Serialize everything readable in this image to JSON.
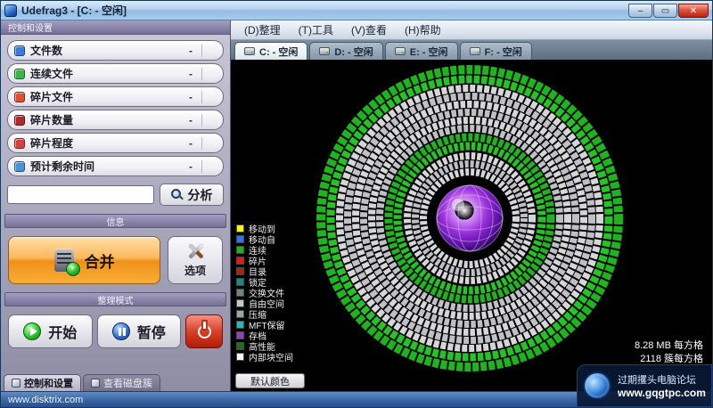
{
  "window": {
    "title": "Udefrag3 - [C: - 空闲]",
    "controls": {
      "minimize": "–",
      "maximize": "▭",
      "close": "✕"
    }
  },
  "menu": {
    "items": [
      "(D)整理",
      "(T)工具",
      "(V)查看",
      "(H)帮助"
    ]
  },
  "drive_tabs": [
    {
      "label": "C: - 空闲",
      "active": true
    },
    {
      "label": "D: - 空闲",
      "active": false
    },
    {
      "label": "E: - 空闲",
      "active": false
    },
    {
      "label": "F: - 空闲",
      "active": false
    }
  ],
  "left_panel": {
    "header": "控制和设置",
    "stats": [
      {
        "label": "文件数",
        "value": "-",
        "icon_color": "#3a7bd5"
      },
      {
        "label": "连续文件",
        "value": "-",
        "icon_color": "#3ab54a"
      },
      {
        "label": "碎片文件",
        "value": "-",
        "icon_color": "#e05030"
      },
      {
        "label": "碎片数量",
        "value": "-",
        "icon_color": "#b02828"
      },
      {
        "label": "碎片程度",
        "value": "-",
        "icon_color": "#d84040"
      },
      {
        "label": "预计剩余时间",
        "value": "-",
        "icon_color": "#4a90d9"
      }
    ],
    "analyze_input_value": "",
    "analyze_button": "分析",
    "info_header": "信息",
    "merge_button": "合并",
    "options_button": "选项",
    "mode_header": "整理模式",
    "start_button": "开始",
    "pause_button": "暂停",
    "bottom_tabs": [
      {
        "label": "控制和设置",
        "active": true
      },
      {
        "label": "查看磁盘簇",
        "active": false
      }
    ]
  },
  "canvas": {
    "legend": [
      {
        "label": "移动到",
        "color": "#f8f800"
      },
      {
        "label": "移动自",
        "color": "#2878f0"
      },
      {
        "label": "连续",
        "color": "#18b418"
      },
      {
        "label": "碎片",
        "color": "#e81818"
      },
      {
        "label": "目录",
        "color": "#a02810"
      },
      {
        "label": "锁定",
        "color": "#188888"
      },
      {
        "label": "交换文件",
        "color": "#6a8878"
      },
      {
        "label": "自由空间",
        "color": "#c8c8c8"
      },
      {
        "label": "压缩",
        "color": "#90a8b0"
      },
      {
        "label": "MFT保留",
        "color": "#28b8b8"
      },
      {
        "label": "存档",
        "color": "#9040c0"
      },
      {
        "label": "高性能",
        "color": "#1a701a"
      },
      {
        "label": "内部块空间",
        "color": "#f8f8f8"
      }
    ],
    "block_size_info": "8.28 MB 每方格",
    "cluster_info": "2118 簇每方格",
    "default_colors_button": "默认颜色"
  },
  "status_bar": {
    "left_text": "www.disktrix.com"
  },
  "watermark": {
    "line1": "过期攫头电脑论坛",
    "line2": "www.gqgtpc.com"
  }
}
